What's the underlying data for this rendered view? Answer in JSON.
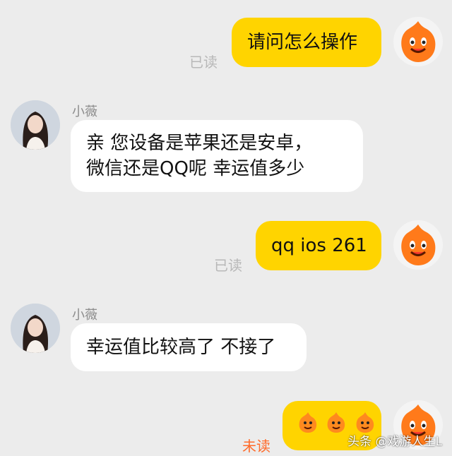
{
  "messages": [
    {
      "side": "me",
      "text": "请问怎么操作",
      "status": "已读"
    },
    {
      "side": "them",
      "sender": "小薇",
      "lines": [
        "亲 您设备是苹果还是安卓，",
        "微信还是QQ呢  幸运值多少"
      ]
    },
    {
      "side": "me",
      "text": "qq ios 261",
      "status": "已读"
    },
    {
      "side": "them",
      "sender": "小薇",
      "lines": [
        "幸运值比较高了 不接了"
      ]
    },
    {
      "side": "me",
      "emoji_count": 3,
      "status": "未读"
    }
  ],
  "watermark": "头条 @戏游人生L",
  "colors": {
    "bubble_me": "#ffd400",
    "bubble_them": "#ffffff",
    "read": "#b8b8b8",
    "unread": "#ff6a2a",
    "bg": "#ececec"
  },
  "icons": {
    "me_avatar": "orange-mascot-icon",
    "them_avatar": "girl-avatar",
    "emoji": "orange-emoji-icon"
  }
}
